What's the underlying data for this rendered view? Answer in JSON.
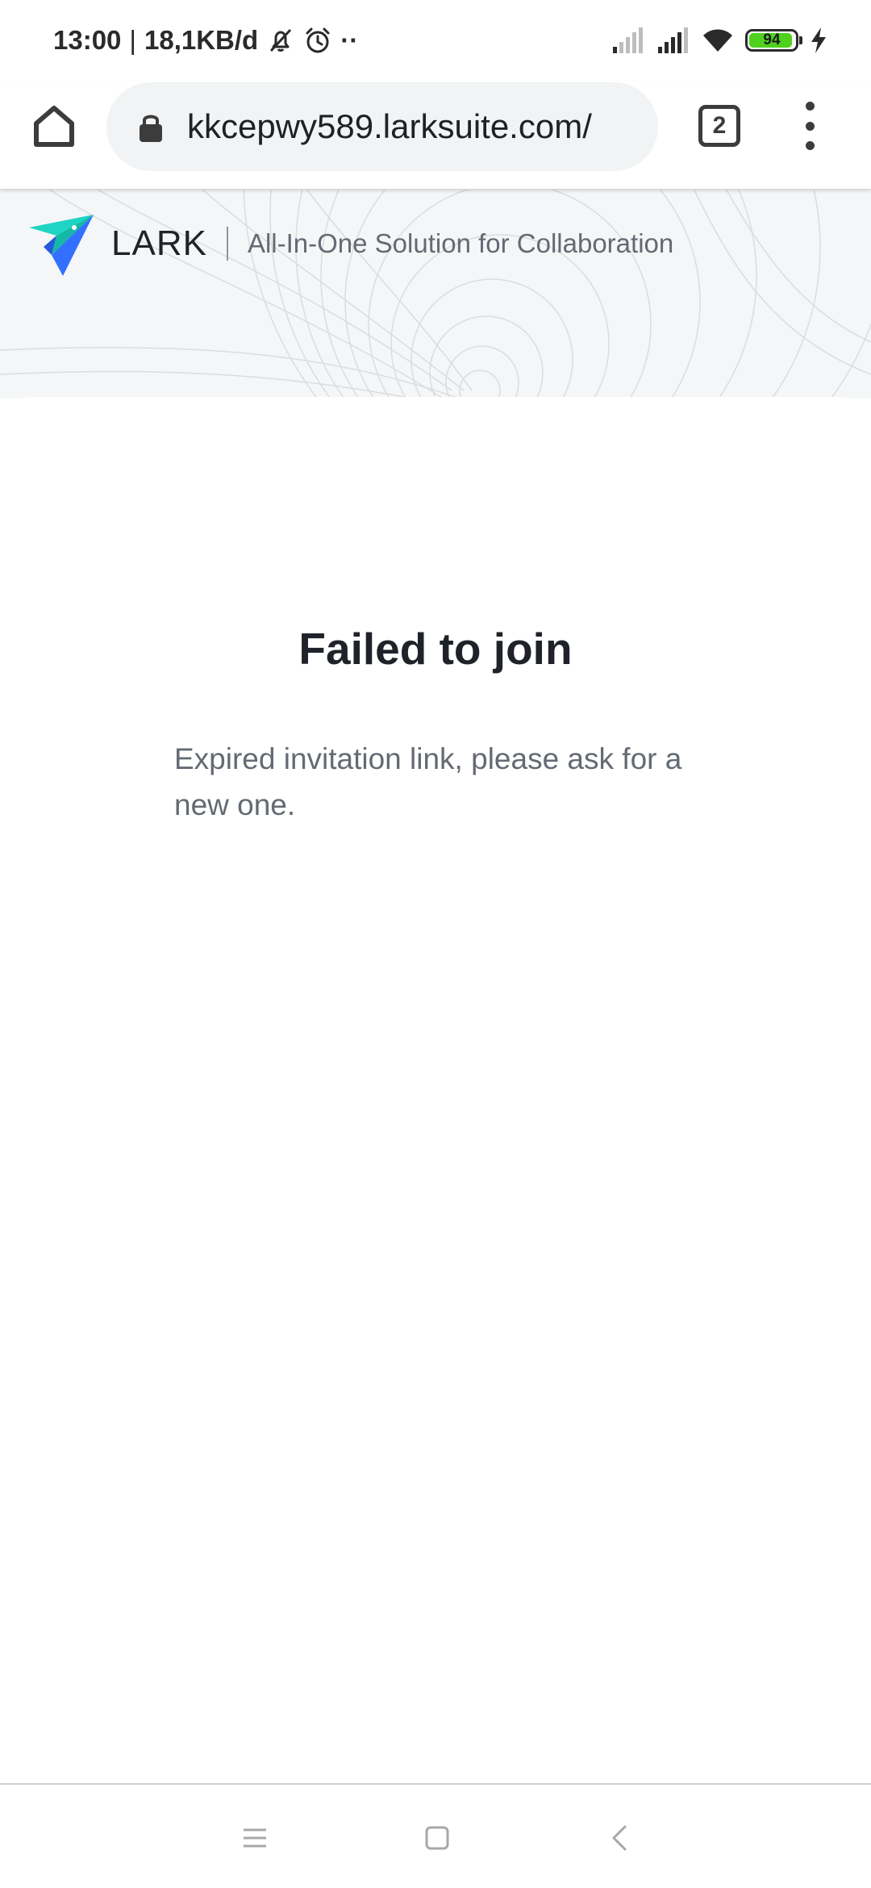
{
  "status_bar": {
    "time": "13:00",
    "separator": "|",
    "data_rate": "18,1KB/d",
    "overflow": "··",
    "battery_level": 94,
    "battery_label": "94",
    "icons": [
      "mute-icon",
      "alarm-icon",
      "signal-weak-icon",
      "signal-icon",
      "wifi-icon",
      "battery-icon",
      "charging-icon"
    ]
  },
  "browser": {
    "url": "kkcepwy589.larksuite.com/",
    "tab_count": "2",
    "icons": [
      "home-icon",
      "lock-icon",
      "tabs-icon",
      "more-vert-icon"
    ]
  },
  "header": {
    "brand_name": "LARK",
    "tagline": "All-In-One Solution for Collaboration"
  },
  "main": {
    "title": "Failed to join",
    "message": "Expired invitation link, please ask for a new one."
  },
  "nav_bar": {
    "icons": [
      "menu-icon",
      "home-square-icon",
      "back-icon"
    ]
  },
  "colors": {
    "text_primary": "#1f2329",
    "text_secondary": "#646a73",
    "url_bar_bg": "#f1f3f4",
    "battery_fill": "#4fd11e",
    "logo_teal": "#1ed4c2",
    "logo_blue": "#3370ff"
  }
}
